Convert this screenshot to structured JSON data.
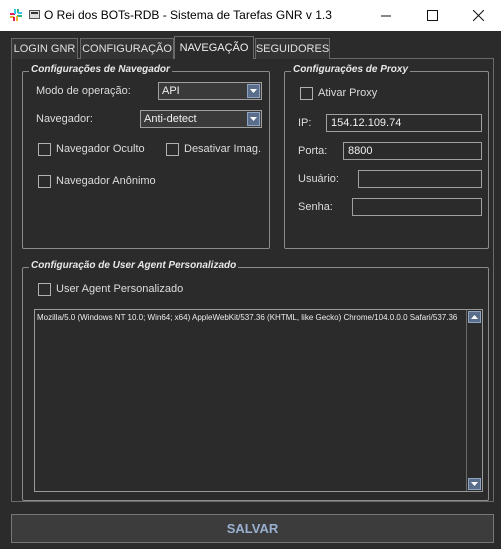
{
  "window": {
    "title": "O Rei dos BOTs-RDB - Sistema de Tarefas GNR v 1.3",
    "minimize_glyph": "—",
    "maximize_glyph": "☐",
    "close_glyph": "✕"
  },
  "tabs": [
    {
      "label": "LOGIN GNR"
    },
    {
      "label": "CONFIGURAÇÃO"
    },
    {
      "label": "NAVEGAÇÃO"
    },
    {
      "label": "SEGUIDORES"
    }
  ],
  "navegador": {
    "group_title": "Configurações de Navegador",
    "modo_label": "Modo de operação:",
    "modo_value": "API",
    "navegador_label": "Navegador:",
    "navegador_value": "Anti-detect",
    "oculto_label": "Navegador Oculto",
    "desativar_label": "Desativar Imag.",
    "anonimo_label": "Navegador Anônimo"
  },
  "proxy": {
    "group_title": "Configurações de Proxy",
    "ativar_label": "Ativar Proxy",
    "ip_label": "IP:",
    "ip_value": "154.12.109.74",
    "porta_label": "Porta:",
    "porta_value": "8800",
    "usuario_label": "Usuário:",
    "usuario_value": "",
    "senha_label": "Senha:",
    "senha_value": ""
  },
  "user_agent": {
    "group_title": "Configuração de User Agent Personalizado",
    "checkbox_label": "User Agent Personalizado",
    "value": "Mozilla/5.0 (Windows NT 10.0; Win64; x64) AppleWebKit/537.36 (KHTML, like Gecko) Chrome/104.0.0.0 Safari/537.36"
  },
  "save_label": "SALVAR"
}
